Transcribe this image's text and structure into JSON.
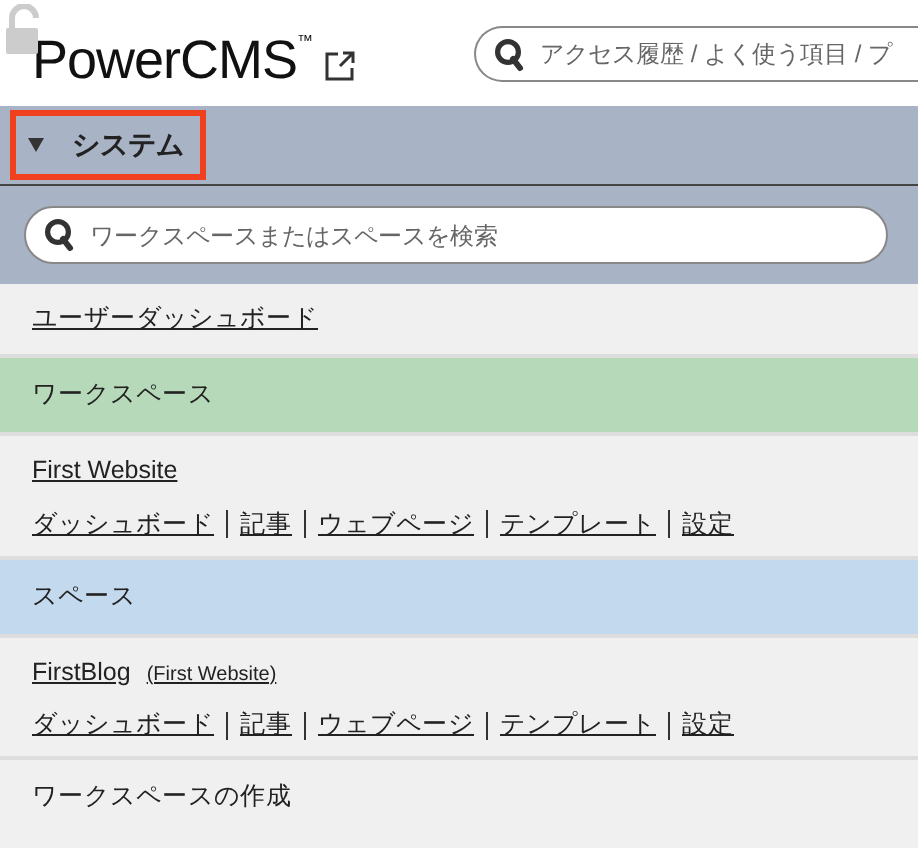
{
  "header": {
    "logo": "PowerCMS",
    "trademark": "™",
    "search": {
      "placeholder": "アクセス履歴 / よく使う項目 / プ"
    }
  },
  "menu": {
    "title": "システム",
    "expanded": true,
    "highlighted": true,
    "search": {
      "placeholder": "ワークスペースまたはスペースを検索"
    }
  },
  "items": [
    {
      "kind": "link",
      "label": "ユーザーダッシュボード"
    },
    {
      "kind": "section",
      "label": "ワークスペース",
      "color": "#b5d9b9"
    },
    {
      "kind": "site",
      "name": "First Website",
      "links": [
        "ダッシュボード",
        "記事",
        "ウェブページ",
        "テンプレート",
        "設定"
      ]
    },
    {
      "kind": "section",
      "label": "スペース",
      "color": "#c3d9ed"
    },
    {
      "kind": "site",
      "name": "FirstBlog",
      "parent": "(First Website)",
      "links": [
        "ダッシュボード",
        "記事",
        "ウェブページ",
        "テンプレート",
        "設定"
      ]
    },
    {
      "kind": "plain",
      "label": "ワークスペースの作成"
    }
  ]
}
